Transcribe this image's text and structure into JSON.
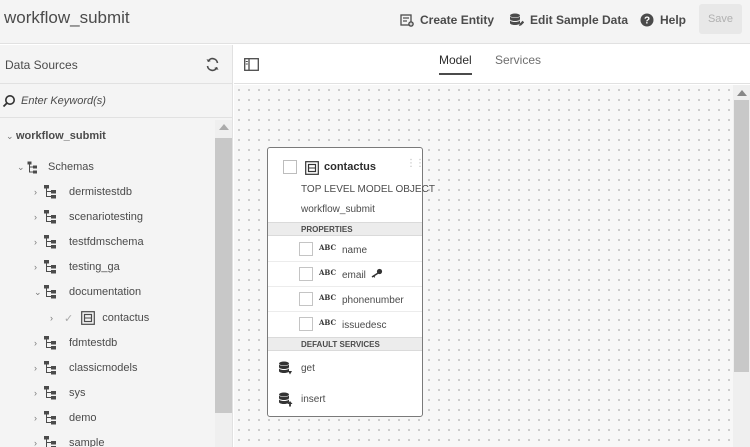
{
  "app": {
    "title": "workflow_submit"
  },
  "header": {
    "create_entity": "Create Entity",
    "edit_sample_data": "Edit Sample Data",
    "help": "Help",
    "save": "Save"
  },
  "left_panel": {
    "title": "Data Sources",
    "search_placeholder": "Enter Keyword(s)",
    "root": "workflow_submit",
    "schemas_label": "Schemas",
    "tree": [
      {
        "label": "dermistestdb",
        "state": "collapsed"
      },
      {
        "label": "scenariotesting",
        "state": "collapsed"
      },
      {
        "label": "testfdmschema",
        "state": "collapsed"
      },
      {
        "label": "testing_ga",
        "state": "collapsed"
      },
      {
        "label": "documentation",
        "state": "expanded"
      },
      {
        "label": "contactus",
        "state": "child-selected"
      },
      {
        "label": "fdmtestdb",
        "state": "collapsed"
      },
      {
        "label": "classicmodels",
        "state": "collapsed"
      },
      {
        "label": "sys",
        "state": "collapsed"
      },
      {
        "label": "demo",
        "state": "collapsed"
      },
      {
        "label": "sample",
        "state": "collapsed"
      }
    ]
  },
  "tabs": {
    "model": "Model",
    "services": "Services",
    "active": "Model"
  },
  "entity": {
    "name": "contactus",
    "subtitle": "TOP LEVEL MODEL OBJECT",
    "source": "workflow_submit",
    "properties_header": "PROPERTIES",
    "type_label": "ABC",
    "properties": [
      {
        "name": "name",
        "is_key": false
      },
      {
        "name": "email",
        "is_key": true
      },
      {
        "name": "phonenumber",
        "is_key": false
      },
      {
        "name": "issuedesc",
        "is_key": false
      }
    ],
    "services_header": "DEFAULT SERVICES",
    "services": [
      {
        "name": "get",
        "icon": "database-get-icon"
      },
      {
        "name": "insert",
        "icon": "database-insert-icon"
      }
    ]
  },
  "colors": {
    "header_bg": "#f4f4f4",
    "canvas_bg": "#f7f7f7",
    "text": "#4b4b4b",
    "border": "#7a7a7a"
  }
}
